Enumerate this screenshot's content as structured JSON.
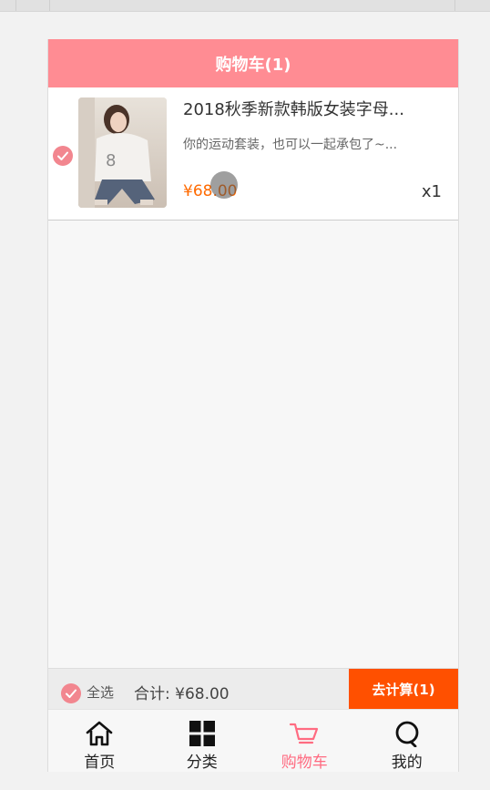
{
  "header": {
    "title": "购物车(1)"
  },
  "cart": {
    "items": [
      {
        "title": "2018秋季新款韩版女装字母...",
        "subtitle": "你的运动套装，也可以一起承包了~...",
        "price": "¥68.00",
        "quantity": "x1",
        "checked": true
      }
    ]
  },
  "checkout": {
    "select_all_label": "全选",
    "total_label": "合计: ¥68.00",
    "button_label": "去计算(1)"
  },
  "nav": {
    "items": [
      {
        "label": "首页",
        "icon": "home-icon",
        "active": false
      },
      {
        "label": "分类",
        "icon": "grid-icon",
        "active": false
      },
      {
        "label": "购物车",
        "icon": "cart-icon",
        "active": true
      },
      {
        "label": "我的",
        "icon": "profile-icon",
        "active": false
      }
    ]
  },
  "colors": {
    "header_bg": "#ff8c93",
    "check_accent": "#f2868f",
    "price": "#ff6a00",
    "checkout_button": "#ff5000",
    "nav_active": "#ff6b81"
  }
}
